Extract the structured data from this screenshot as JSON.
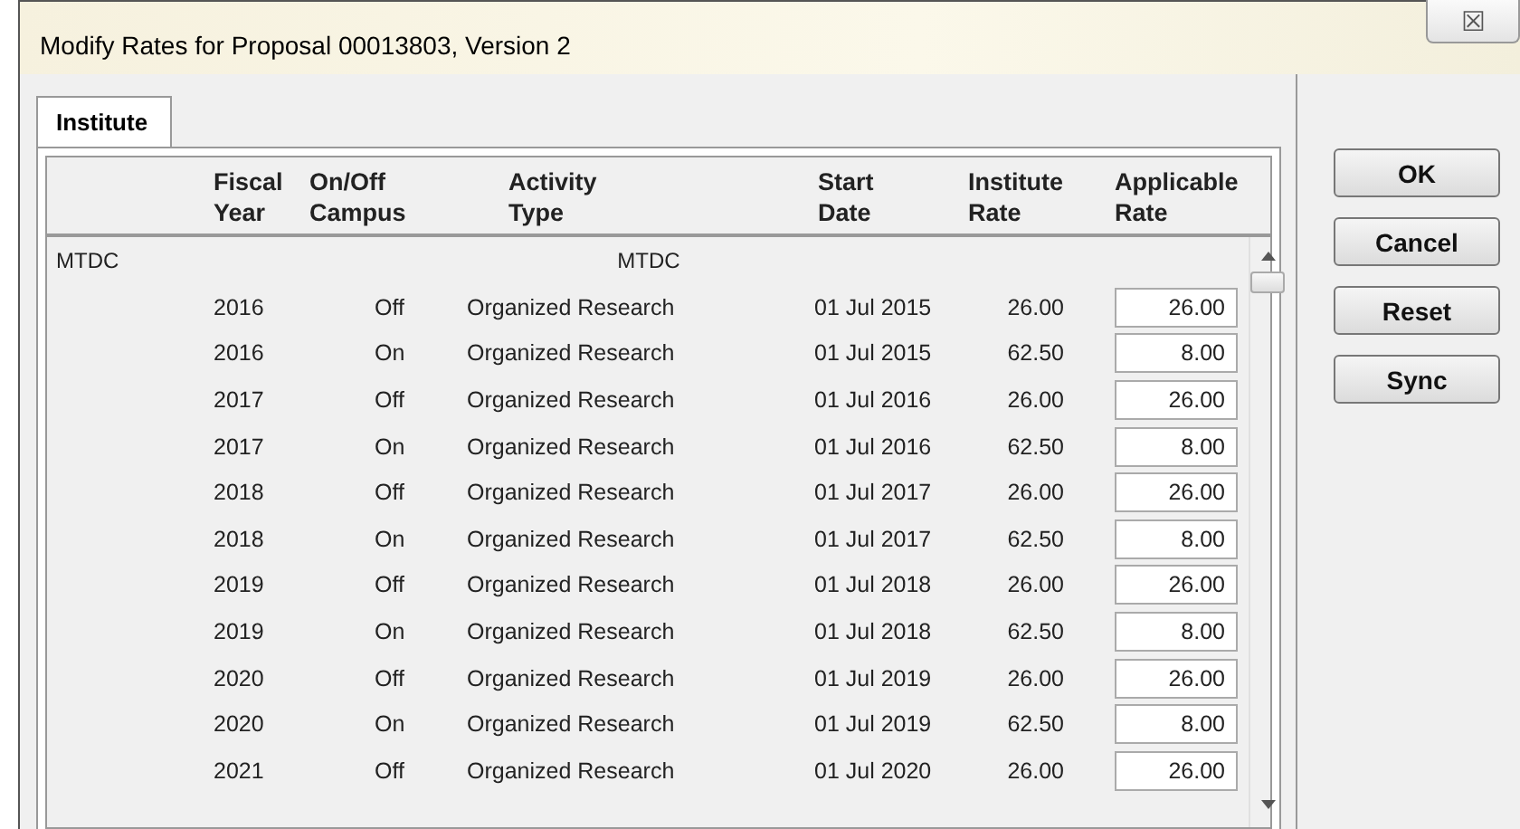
{
  "window": {
    "title": "Modify Rates for Proposal 00013803, Version 2",
    "close_glyph": "☒"
  },
  "tabs": [
    {
      "label": "Institute",
      "selected": true
    }
  ],
  "table": {
    "columns": [
      "",
      "Fiscal Year",
      "On/Off Campus",
      "Activity Type",
      "Start Date",
      "Institute Rate",
      "Applicable Rate"
    ],
    "group": {
      "label": "MTDC",
      "caption": "MTDC"
    },
    "rows": [
      {
        "fiscal_year": "2016",
        "campus": "Off",
        "activity_type": "Organized Research",
        "start_date": "01 Jul 2015",
        "institute_rate": "26.00",
        "applicable_rate": "26.00"
      },
      {
        "fiscal_year": "2016",
        "campus": "On",
        "activity_type": "Organized Research",
        "start_date": "01 Jul 2015",
        "institute_rate": "62.50",
        "applicable_rate": "8.00"
      },
      {
        "fiscal_year": "2017",
        "campus": "Off",
        "activity_type": "Organized Research",
        "start_date": "01 Jul 2016",
        "institute_rate": "26.00",
        "applicable_rate": "26.00"
      },
      {
        "fiscal_year": "2017",
        "campus": "On",
        "activity_type": "Organized Research",
        "start_date": "01 Jul 2016",
        "institute_rate": "62.50",
        "applicable_rate": "8.00"
      },
      {
        "fiscal_year": "2018",
        "campus": "Off",
        "activity_type": "Organized Research",
        "start_date": "01 Jul 2017",
        "institute_rate": "26.00",
        "applicable_rate": "26.00"
      },
      {
        "fiscal_year": "2018",
        "campus": "On",
        "activity_type": "Organized Research",
        "start_date": "01 Jul 2017",
        "institute_rate": "62.50",
        "applicable_rate": "8.00"
      },
      {
        "fiscal_year": "2019",
        "campus": "Off",
        "activity_type": "Organized Research",
        "start_date": "01 Jul 2018",
        "institute_rate": "26.00",
        "applicable_rate": "26.00"
      },
      {
        "fiscal_year": "2019",
        "campus": "On",
        "activity_type": "Organized Research",
        "start_date": "01 Jul 2018",
        "institute_rate": "62.50",
        "applicable_rate": "8.00"
      },
      {
        "fiscal_year": "2020",
        "campus": "Off",
        "activity_type": "Organized Research",
        "start_date": "01 Jul 2019",
        "institute_rate": "26.00",
        "applicable_rate": "26.00"
      },
      {
        "fiscal_year": "2020",
        "campus": "On",
        "activity_type": "Organized Research",
        "start_date": "01 Jul 2019",
        "institute_rate": "62.50",
        "applicable_rate": "8.00"
      },
      {
        "fiscal_year": "2021",
        "campus": "Off",
        "activity_type": "Organized Research",
        "start_date": "01 Jul 2020",
        "institute_rate": "26.00",
        "applicable_rate": "26.00"
      }
    ]
  },
  "buttons": [
    "OK",
    "Cancel",
    "Reset",
    "Sync"
  ]
}
